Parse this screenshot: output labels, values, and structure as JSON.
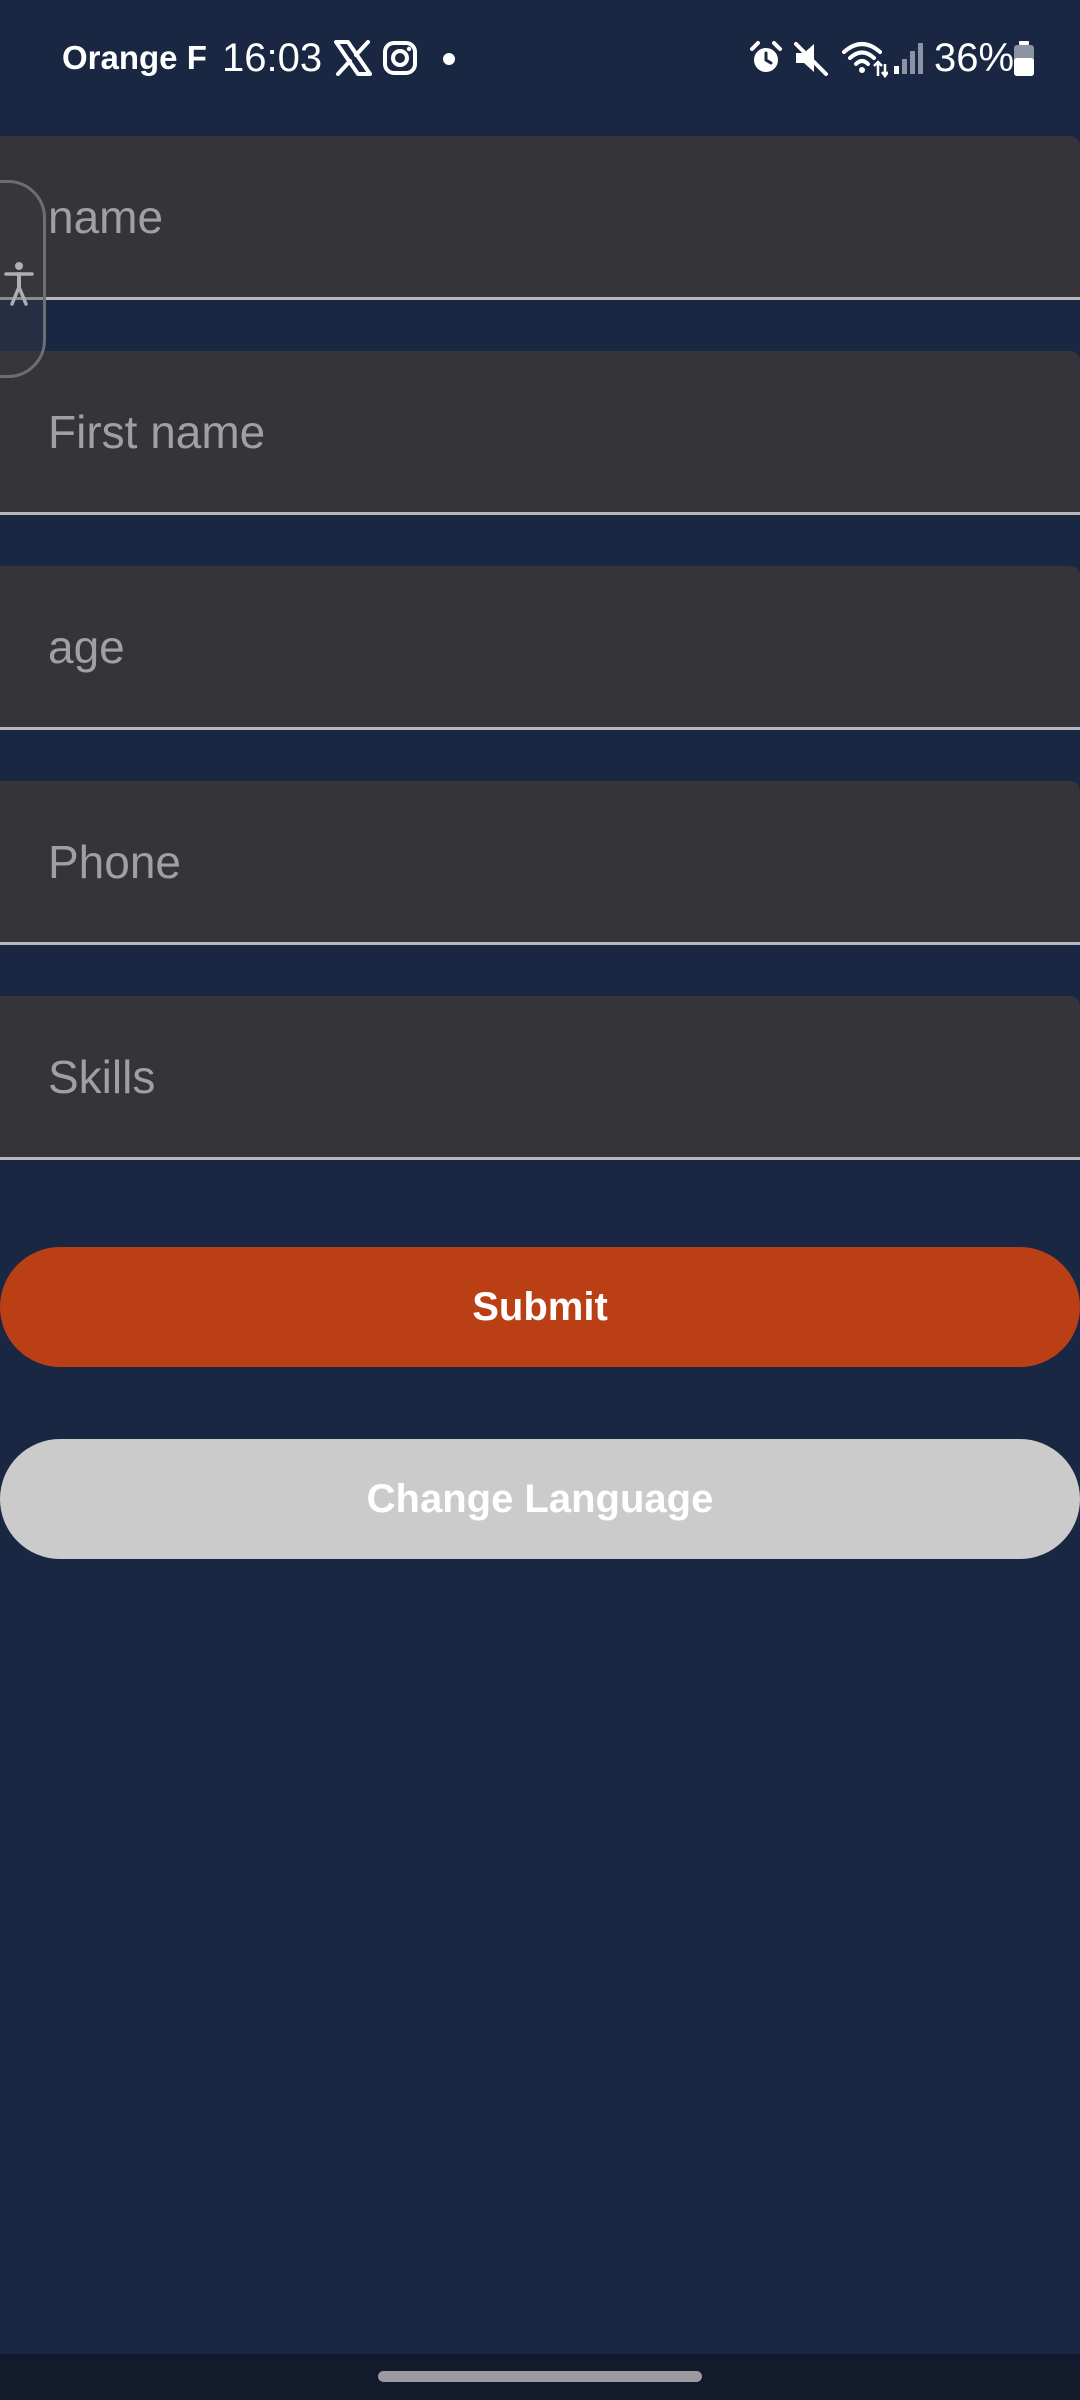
{
  "status_bar": {
    "carrier": "Orange F",
    "time": "16:03",
    "battery": "36%",
    "icons": [
      "x-logo-icon",
      "instagram-icon",
      "notification-dot-icon",
      "alarm-icon",
      "mute-icon",
      "wifi-icon",
      "signal-icon",
      "battery-icon"
    ]
  },
  "form": {
    "fields": [
      {
        "placeholder": "name",
        "value": ""
      },
      {
        "placeholder": "First name",
        "value": ""
      },
      {
        "placeholder": "age",
        "value": ""
      },
      {
        "placeholder": "Phone",
        "value": ""
      },
      {
        "placeholder": "Skills",
        "value": ""
      }
    ],
    "submit_label": "Submit",
    "language_label": "Change Language"
  },
  "accessibility": {
    "icon": "accessibility-icon"
  },
  "colors": {
    "background": "#1a2742",
    "field_fill": "#353438",
    "submit": "#bb3f15",
    "language": "#cbcbcb"
  }
}
